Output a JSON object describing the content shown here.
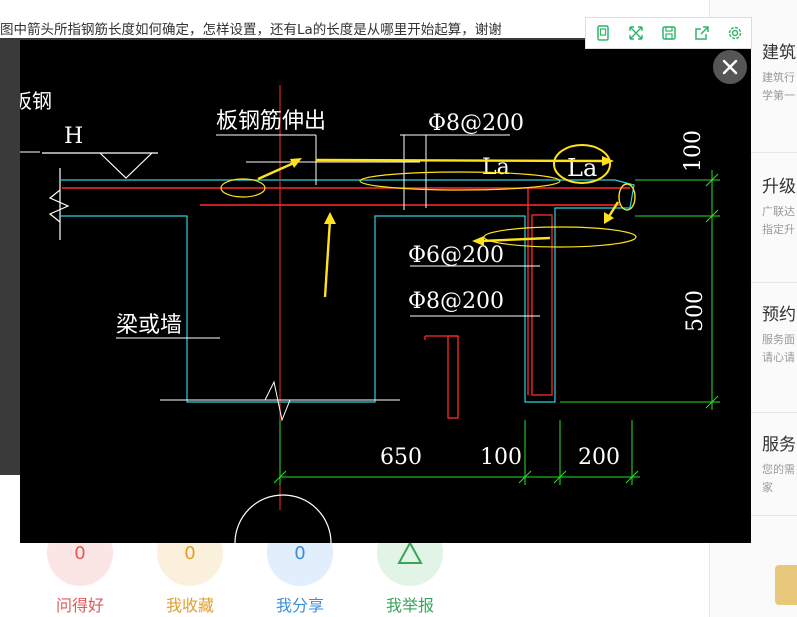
{
  "question": {
    "title": "图中箭头所指钢筋长度如何确定，怎样设置，还有La的长度是从哪里开始起算，谢谢"
  },
  "toolbar": {
    "buttons": [
      {
        "icon": "phone-icon"
      },
      {
        "icon": "expand-icon"
      },
      {
        "icon": "save-icon"
      },
      {
        "icon": "share-icon"
      },
      {
        "icon": "gear-icon"
      }
    ],
    "color": "#2fb56a"
  },
  "right_panel": {
    "cards": [
      {
        "title": "建筑",
        "desc1": "建筑行",
        "desc2": "学第一"
      },
      {
        "title": "升级",
        "desc1": "广联达",
        "desc2": "指定升"
      },
      {
        "title": "预约",
        "desc1": "服务面",
        "desc2": "请心请"
      },
      {
        "title": "服务",
        "desc1": "您的需",
        "desc2": "家"
      }
    ]
  },
  "stats": [
    {
      "count": "0",
      "label": "问得好",
      "color": "#e05a5a",
      "bg": "#fbe5e5"
    },
    {
      "count": "0",
      "label": "我收藏",
      "color": "#e0a030",
      "bg": "#fbf0dc"
    },
    {
      "count": "0",
      "label": "我分享",
      "color": "#3b8fd9",
      "bg": "#e1eefb"
    },
    {
      "count": "",
      "label": "我举报",
      "color": "#3aa55a",
      "bg": "#e2f4e6"
    }
  ],
  "drawing": {
    "label_h": "H",
    "label_slab_bar": "板钢筋伸出",
    "label_top_bar": "Φ8@200",
    "label_la_1": "La",
    "label_la_2": "La",
    "label_dim_100_v": "100",
    "label_stirrup_1": "Φ6@200",
    "label_stirrup_2": "Φ8@200",
    "label_beam_wall": "梁或墙",
    "label_dim_500": "500",
    "label_dim_650": "650",
    "label_dim_100_h": "100",
    "label_dim_200": "200",
    "label_left_edge": "板钢"
  }
}
